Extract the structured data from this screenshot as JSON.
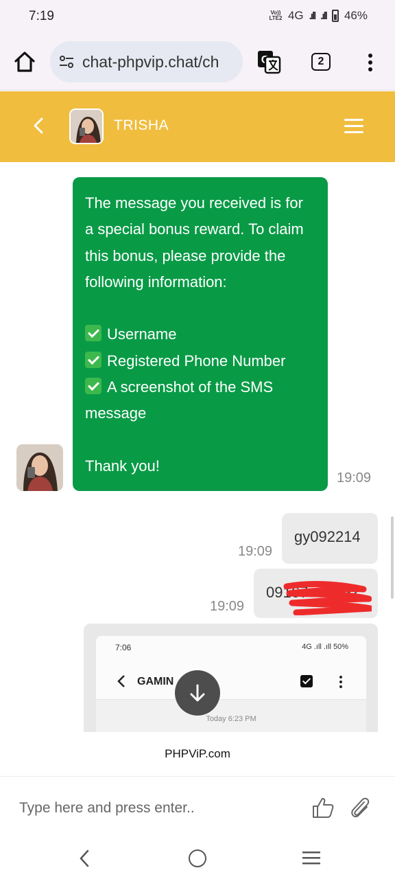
{
  "status_bar": {
    "time": "7:19",
    "network_badge_top": "Vo))",
    "network_badge_bottom": "LTE2",
    "network_type": "4G",
    "battery": "46%"
  },
  "browser": {
    "url": "chat-phpvip.chat/ch",
    "tab_count": "2",
    "icons": [
      "home-icon",
      "tune-icon",
      "translate-icon",
      "more-vert-icon"
    ]
  },
  "chat_header": {
    "contact_name": "TRISHA",
    "background_color": "#f0bd3f"
  },
  "messages": {
    "bot": {
      "intro": "The message you received is for a special bonus reward. To claim this bonus, please provide the following information:",
      "items": [
        "Username",
        "Registered Phone Number",
        "A screenshot of the SMS message"
      ],
      "closing": "Thank you!",
      "time": "19:09",
      "color": "#099a46"
    },
    "user_1": {
      "text": "gy092214",
      "time": "19:09"
    },
    "user_2": {
      "text": "09167",
      "trailing": "92",
      "time": "19:09"
    },
    "screenshot": {
      "time": "7:06",
      "status": "4G .ıll .ıll 50%",
      "title": "GAMIN",
      "date": "Today 6:23 PM"
    }
  },
  "footer": {
    "brand": "PHPViP.com",
    "input_placeholder": "Type here and press enter.."
  }
}
